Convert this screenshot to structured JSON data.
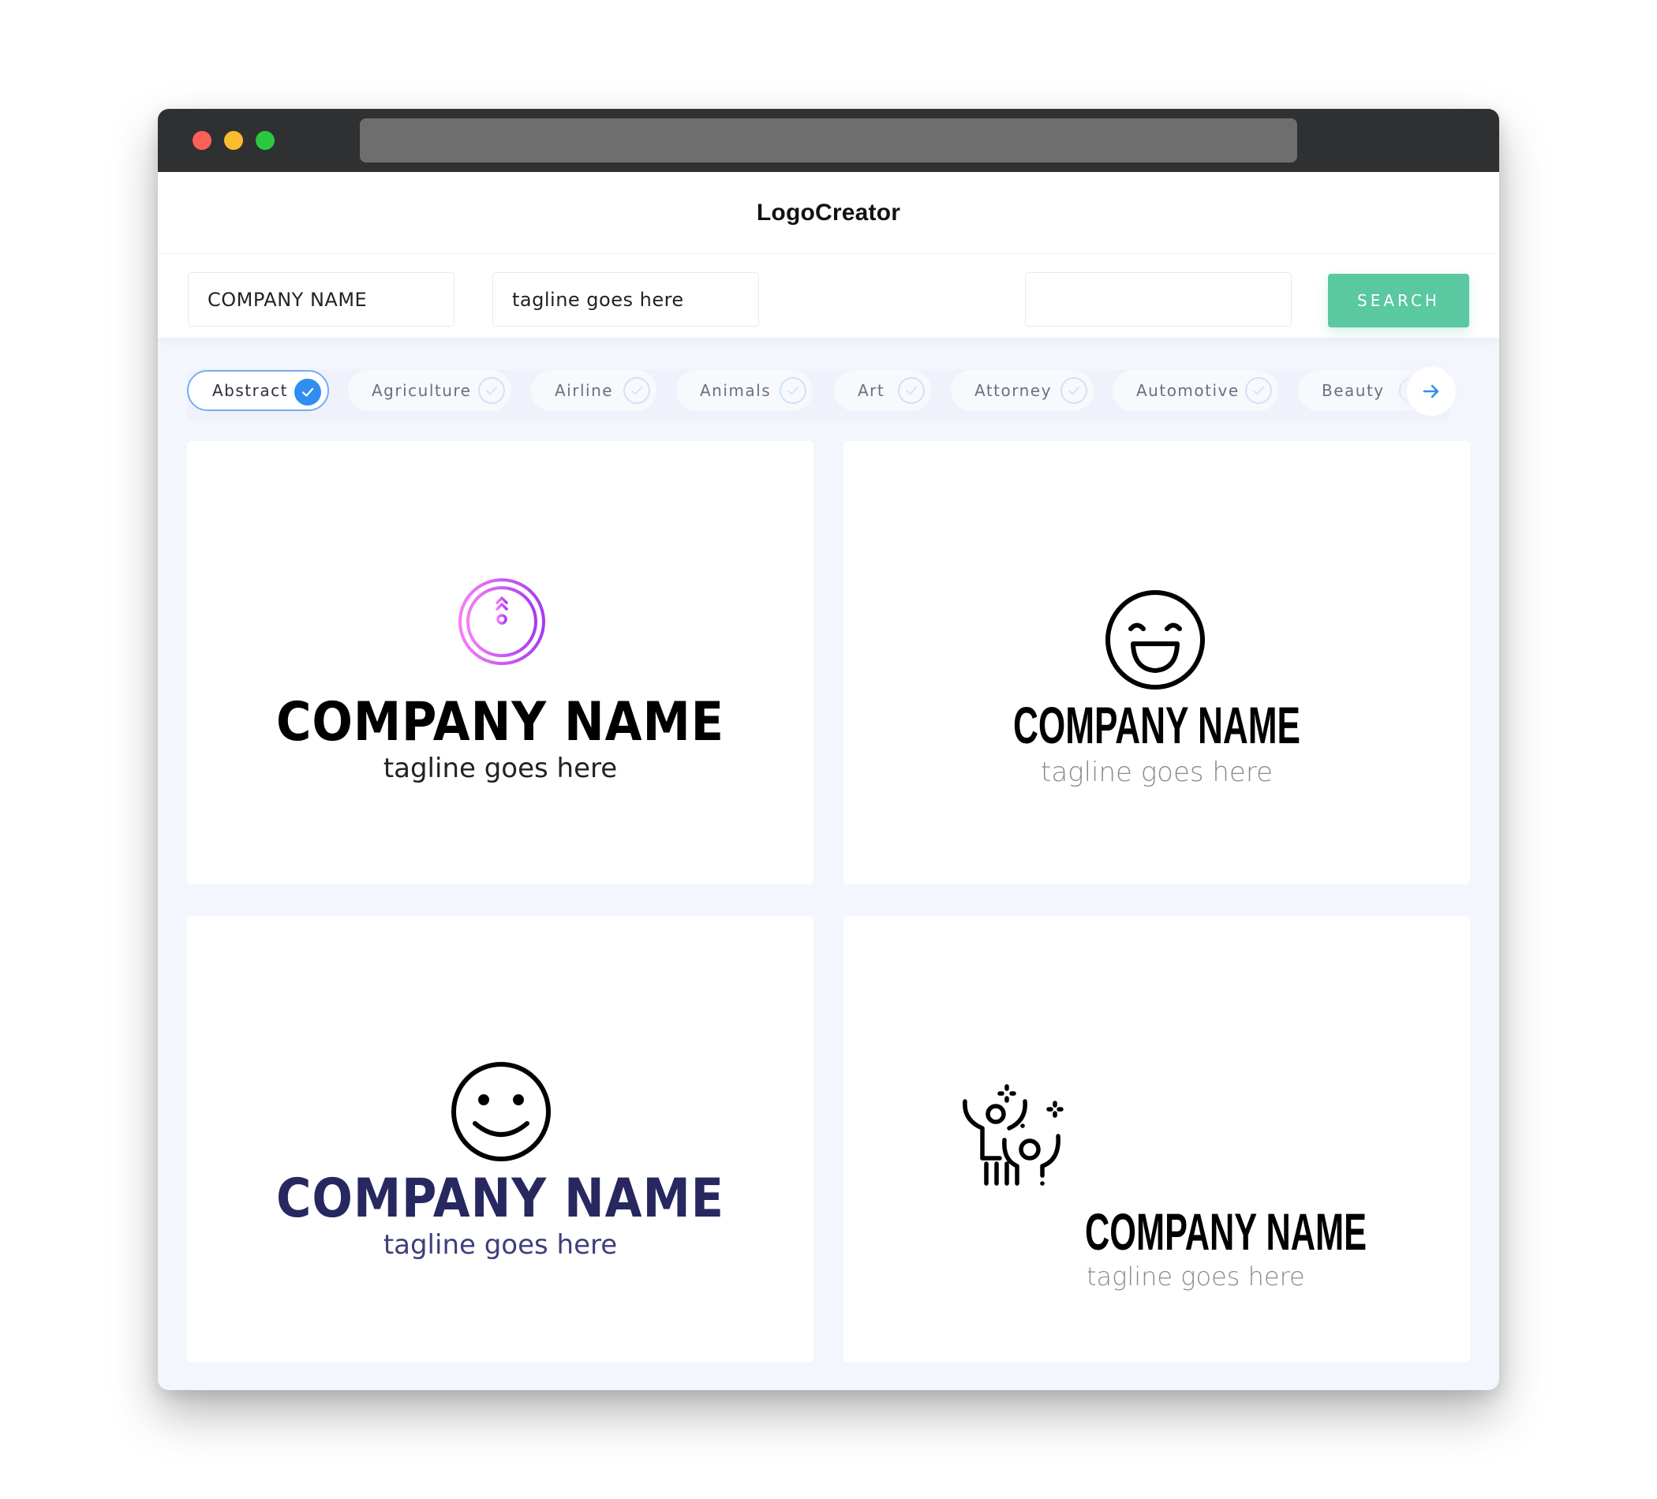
{
  "app": {
    "title": "LogoCreator"
  },
  "search": {
    "company_name_value": "COMPANY NAME",
    "tagline_value": "tagline goes here",
    "keyword_value": "",
    "search_button_label": "SEARCH"
  },
  "categories": {
    "items": [
      {
        "label": "Abstract",
        "selected": true
      },
      {
        "label": "Agriculture",
        "selected": false
      },
      {
        "label": "Airline",
        "selected": false
      },
      {
        "label": "Animals",
        "selected": false
      },
      {
        "label": "Art",
        "selected": false
      },
      {
        "label": "Attorney",
        "selected": false
      },
      {
        "label": "Automotive",
        "selected": false
      },
      {
        "label": "Beauty",
        "selected": false
      }
    ],
    "next_icon": "arrow-right-icon"
  },
  "logos": [
    {
      "icon": "clock-icon",
      "company_name": "COMPANY NAME",
      "tagline": "tagline goes here",
      "name_color": "#000000",
      "tagline_color": "#222222",
      "icon_gradient": [
        "#f57ef5",
        "#a63cf0"
      ]
    },
    {
      "icon": "laughing-face-icon",
      "company_name": "COMPANY NAME",
      "tagline": "tagline goes here",
      "name_color": "#000000",
      "tagline_color": "#8a8a8a"
    },
    {
      "icon": "smiley-face-icon",
      "company_name": "COMPANY NAME",
      "tagline": "tagline goes here",
      "name_color": "#272860",
      "tagline_color": "#3e3f7a"
    },
    {
      "icon": "celebrating-people-icon",
      "company_name": "COMPANY NAME",
      "tagline": "tagline goes here",
      "name_color": "#000000",
      "tagline_color": "#8a8a8a"
    }
  ],
  "colors": {
    "accent_green": "#5ac8a0",
    "accent_blue": "#2f8ef0",
    "titlebar": "#2f3032"
  }
}
